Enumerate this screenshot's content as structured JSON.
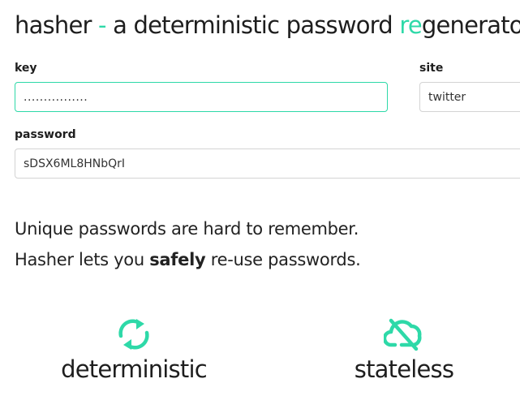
{
  "header": {
    "title_part1": "hasher ",
    "title_dash": "-",
    "title_part2": " a deterministic password ",
    "title_accent": "re",
    "title_part3": "generator."
  },
  "form": {
    "key_label": "key",
    "key_value": "................",
    "site_label": "site",
    "site_value": "twitter",
    "password_label": "password",
    "password_value": "sDSX6ML8HNbQrI"
  },
  "tagline": {
    "line1": "Unique passwords are hard to remember.",
    "line2_prefix": "Hasher lets you ",
    "line2_bold": "safely",
    "line2_suffix": " re-use passwords."
  },
  "features": [
    {
      "icon": "refresh-icon",
      "label": "deterministic"
    },
    {
      "icon": "cloud-off-icon",
      "label": "stateless"
    }
  ],
  "colors": {
    "accent": "#2ed9a8",
    "text": "#1e1e1e",
    "border": "#d3d3d3"
  }
}
